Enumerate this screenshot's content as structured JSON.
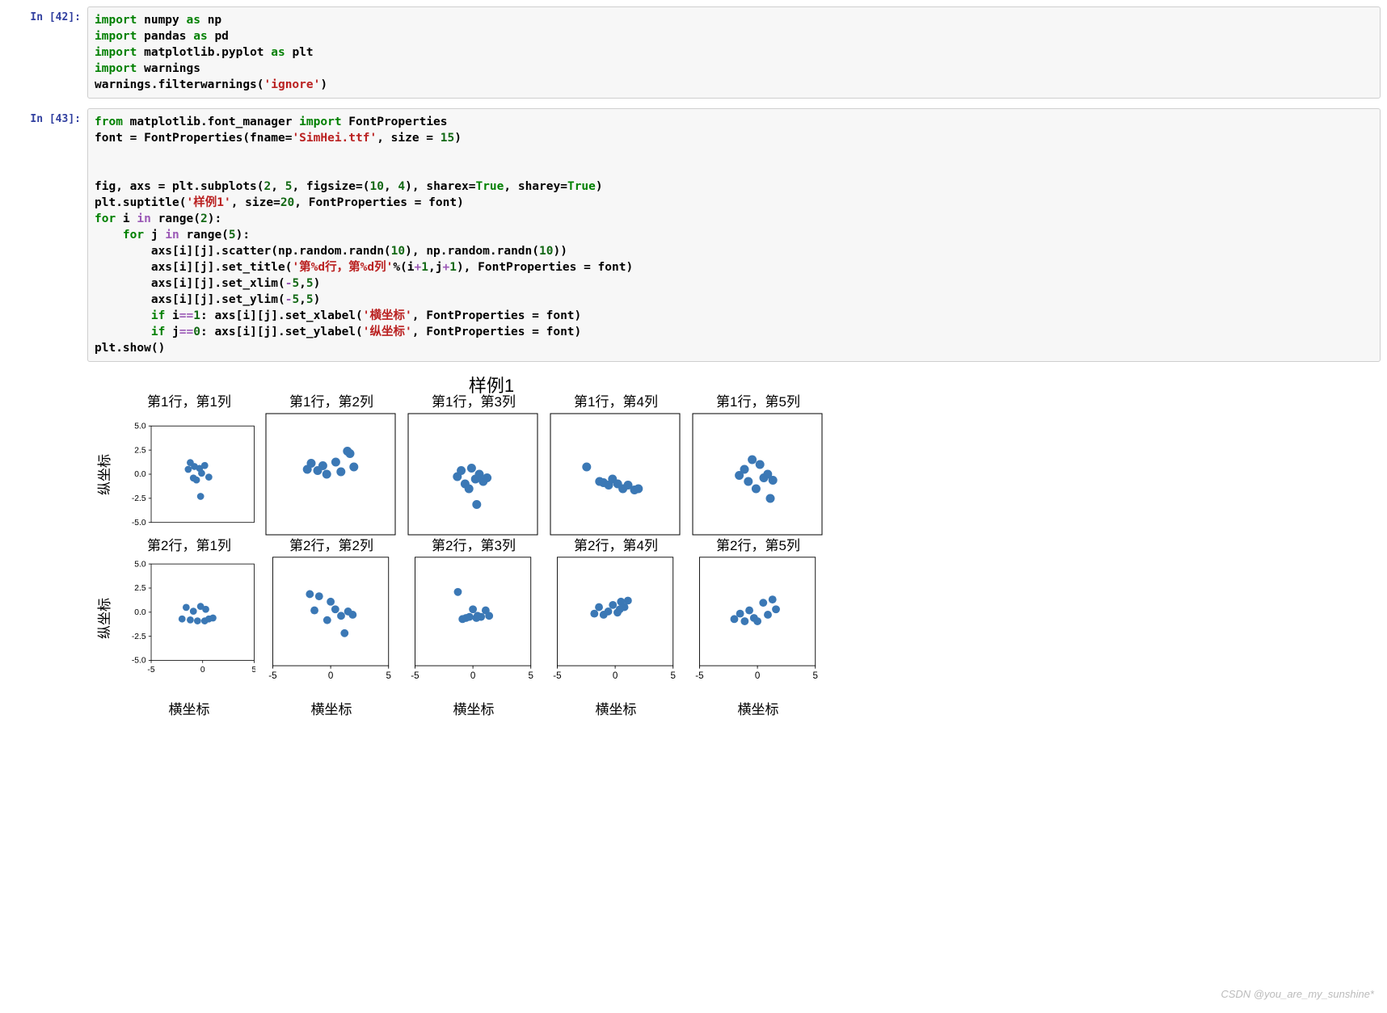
{
  "cells": [
    {
      "prompt": "In [42]:",
      "code_html": "<span class='kw'>import</span> numpy <span class='kw'>as</span> <span class='nm'>np</span>\n<span class='kw'>import</span> pandas <span class='kw'>as</span> <span class='nm'>pd</span>\n<span class='kw'>import</span> matplotlib.pyplot <span class='kw'>as</span> <span class='nm'>plt</span>\n<span class='kw'>import</span> warnings\nwarnings.filterwarnings(<span class='str'>'ignore'</span>)"
    },
    {
      "prompt": "In [43]:",
      "code_html": "<span class='kw'>from</span> matplotlib.font_manager <span class='kw'>import</span> FontProperties\nfont = FontProperties(fname=<span class='str'>'SimHei.ttf'</span>, size = <span class='num'>15</span>)\n\n\nfig, axs = plt.subplots(<span class='num'>2</span>, <span class='num'>5</span>, figsize=(<span class='num'>10</span>, <span class='num'>4</span>), sharex=<span class='bool'>True</span>, sharey=<span class='bool'>True</span>)\nplt.suptitle(<span class='str'>'样例1'</span>, size=<span class='num'>20</span>, FontProperties = font)\n<span class='kw'>for</span> i <span class='op'>in</span> range(<span class='num'>2</span>):\n    <span class='kw'>for</span> j <span class='op'>in</span> range(<span class='num'>5</span>):\n        axs[i][j].scatter(np.random.randn(<span class='num'>10</span>), np.random.randn(<span class='num'>10</span>))\n        axs[i][j].set_title(<span class='str'>'第%d行，第%d列'</span>%(i<span class='op'>+</span><span class='num'>1</span>,j<span class='op'>+</span><span class='num'>1</span>), FontProperties = font)\n        axs[i][j].set_xlim(<span class='op'>-</span><span class='num'>5</span>,<span class='num'>5</span>)\n        axs[i][j].set_ylim(<span class='op'>-</span><span class='num'>5</span>,<span class='num'>5</span>)\n        <span class='kw'>if</span> i<span class='op'>==</span><span class='num'>1</span>: axs[i][j].set_xlabel(<span class='str'>'横坐标'</span>, FontProperties = font)\n        <span class='kw'>if</span> j<span class='op'>==</span><span class='num'>0</span>: axs[i][j].set_ylabel(<span class='str'>'纵坐标'</span>, FontProperties = font)\nplt.show()"
    }
  ],
  "chart_data": {
    "type": "scatter",
    "suptitle": "样例1",
    "xlabel": "横坐标",
    "ylabel": "纵坐标",
    "xlim": [
      -5,
      5
    ],
    "ylim": [
      -5,
      5
    ],
    "xticks": [
      -5,
      0,
      5
    ],
    "yticks": [
      -5.0,
      -2.5,
      0.0,
      2.5,
      5.0
    ],
    "rows": 2,
    "cols": 5,
    "subplot_titles": [
      [
        "第1行，第1列",
        "第1行，第2列",
        "第1行，第3列",
        "第1行，第4列",
        "第1行，第5列"
      ],
      [
        "第2行，第1列",
        "第2行，第2列",
        "第2行，第3列",
        "第2行，第4列",
        "第2行，第5列"
      ]
    ],
    "subplots": [
      [
        {
          "x": [
            -1.4,
            -1.2,
            -0.9,
            -0.8,
            -0.6,
            -0.3,
            -0.2,
            0.2,
            0.6,
            -0.1
          ],
          "y": [
            0.5,
            1.2,
            -0.4,
            0.8,
            -0.6,
            0.6,
            -2.3,
            0.9,
            -0.3,
            0.1
          ]
        },
        {
          "x": [
            -1.8,
            -1.5,
            -1.0,
            -0.6,
            -0.3,
            0.4,
            0.8,
            1.3,
            1.5,
            1.8
          ],
          "y": [
            0.4,
            0.9,
            0.3,
            0.7,
            0.0,
            1.0,
            0.2,
            1.9,
            1.7,
            0.6
          ]
        },
        {
          "x": [
            -1.2,
            -0.9,
            -0.6,
            -0.3,
            -0.1,
            0.2,
            0.5,
            0.8,
            1.1,
            0.3
          ],
          "y": [
            -0.2,
            0.3,
            -0.8,
            -1.2,
            0.5,
            -0.4,
            0.0,
            -0.6,
            -0.3,
            -2.5
          ]
        },
        {
          "x": [
            -2.2,
            -1.2,
            -0.9,
            -0.5,
            -0.2,
            0.2,
            0.6,
            1.0,
            1.5,
            1.8
          ],
          "y": [
            0.6,
            -0.6,
            -0.7,
            -0.9,
            -0.4,
            -0.8,
            -1.2,
            -0.9,
            -1.3,
            -1.2
          ]
        },
        {
          "x": [
            -1.4,
            -1.0,
            -0.7,
            -0.4,
            -0.1,
            0.2,
            0.5,
            0.8,
            1.2,
            1.0
          ],
          "y": [
            -0.1,
            0.4,
            -0.6,
            1.2,
            -1.2,
            0.8,
            -0.3,
            0.0,
            -0.5,
            -2.0
          ]
        }
      ],
      [
        {
          "x": [
            -2.0,
            -1.6,
            -1.2,
            -0.9,
            -0.5,
            -0.2,
            0.2,
            0.6,
            0.3,
            1.0
          ],
          "y": [
            -0.7,
            0.5,
            -0.8,
            0.1,
            -0.9,
            0.6,
            -0.9,
            -0.7,
            0.3,
            -0.6
          ]
        },
        {
          "x": [
            -1.8,
            -1.4,
            -1.0,
            -0.3,
            0.0,
            0.4,
            0.9,
            1.5,
            1.9,
            1.2
          ],
          "y": [
            1.6,
            0.1,
            1.4,
            -0.8,
            0.9,
            0.2,
            -0.4,
            0.0,
            -0.3,
            -2.0
          ]
        },
        {
          "x": [
            -1.3,
            -0.9,
            -0.6,
            -0.3,
            0.0,
            0.3,
            0.7,
            1.1,
            1.4,
            0.4
          ],
          "y": [
            1.8,
            -0.7,
            -0.6,
            -0.5,
            0.2,
            -0.6,
            -0.5,
            0.1,
            -0.4,
            -0.4
          ]
        },
        {
          "x": [
            -1.8,
            -1.4,
            -1.0,
            -0.6,
            -0.2,
            0.2,
            0.5,
            0.8,
            1.1,
            0.4
          ],
          "y": [
            -0.2,
            0.4,
            -0.3,
            0.0,
            0.6,
            -0.1,
            0.9,
            0.4,
            1.0,
            0.2
          ]
        },
        {
          "x": [
            -2.0,
            -1.5,
            -1.1,
            -0.7,
            -0.3,
            0.5,
            0.9,
            1.3,
            1.6,
            0.0
          ],
          "y": [
            -0.7,
            -0.2,
            -0.9,
            0.1,
            -0.6,
            0.8,
            -0.3,
            1.1,
            0.2,
            -0.9
          ]
        }
      ]
    ]
  },
  "watermark": "CSDN @you_are_my_sunshine*"
}
